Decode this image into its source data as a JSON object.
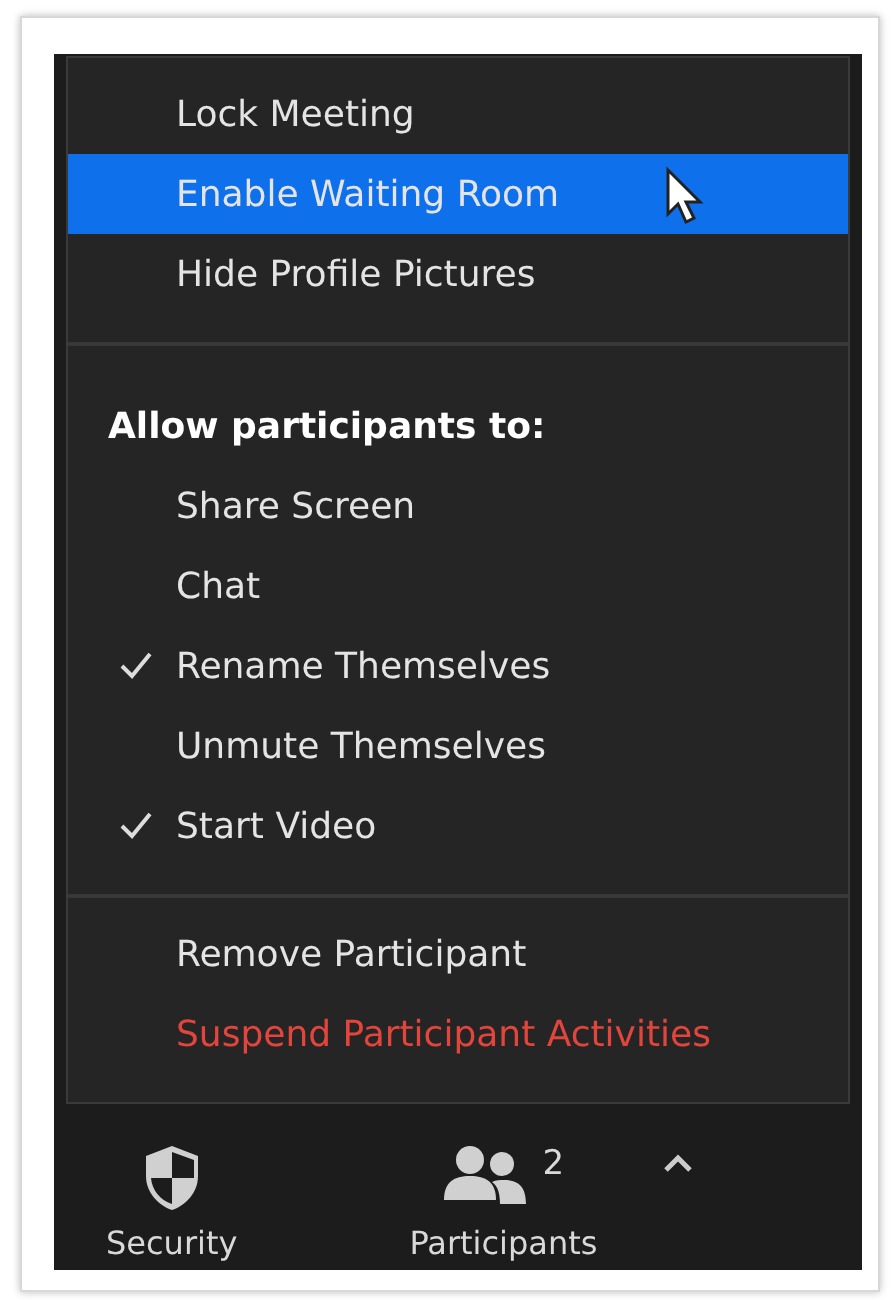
{
  "menu": {
    "sections": [
      {
        "items": [
          {
            "kind": "item",
            "label": "Lock Meeting",
            "selected": false
          },
          {
            "kind": "item",
            "label": "Enable Waiting Room",
            "selected": true
          },
          {
            "kind": "item",
            "label": "Hide Profile Pictures",
            "selected": false
          }
        ]
      },
      {
        "items": [
          {
            "kind": "header",
            "label": "Allow participants to:"
          },
          {
            "kind": "item",
            "label": "Share Screen",
            "checked": false
          },
          {
            "kind": "item",
            "label": "Chat",
            "checked": false
          },
          {
            "kind": "item",
            "label": "Rename Themselves",
            "checked": true
          },
          {
            "kind": "item",
            "label": "Unmute Themselves",
            "checked": false
          },
          {
            "kind": "item",
            "label": "Start Video",
            "checked": true
          }
        ]
      },
      {
        "items": [
          {
            "kind": "item",
            "label": "Remove Participant"
          },
          {
            "kind": "danger",
            "label": "Suspend Participant Activities"
          }
        ]
      }
    ]
  },
  "toolbar": {
    "security": {
      "label": "Security"
    },
    "participants": {
      "label": "Participants",
      "count": "2"
    }
  }
}
